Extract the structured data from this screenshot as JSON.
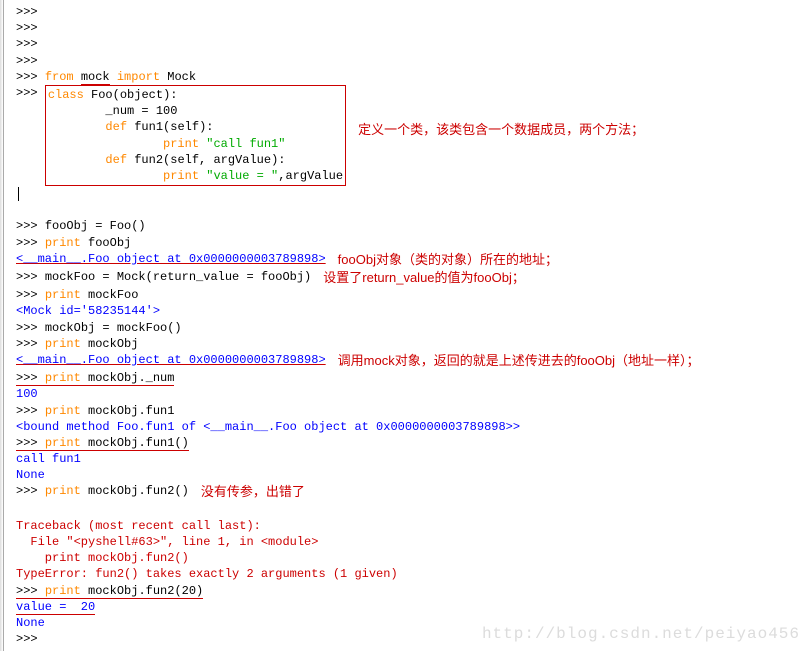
{
  "prompt": ">>> ",
  "empty_lines": [
    ">>> ",
    ">>> ",
    ">>> ",
    ">>> "
  ],
  "import_line": {
    "kw_from": "from",
    "mod": "mock",
    "kw_import": "import",
    "name": "Mock"
  },
  "class_def": {
    "kw_class": "class",
    "cls": "Foo",
    "base": "object",
    "attr": "_num = 100",
    "kw_def": "def",
    "f1": "fun1",
    "self": "self",
    "kw_print": "print",
    "s1": "\"call fun1\"",
    "f2": "fun2",
    "args2": "self, argValue",
    "s2": "\"value = \"",
    "arg2": ",argValue"
  },
  "anno1": "定义一个类，该类包含一个数据成员，两个方法；",
  "l_fooObj": "fooObj = Foo()",
  "l_print_fooObj_kw": "print",
  "l_print_fooObj": " fooObj",
  "addr1": "<__main__.Foo object at 0x0000000003789898>",
  "anno2": "fooObj对象（类的对象）所在的地址；",
  "l_mockFoo": "mockFoo = Mock(return_value = fooObj)",
  "anno3": "设置了return_value的值为fooObj；",
  "l_print_mockFoo_kw": "print",
  "l_print_mockFoo": " mockFoo",
  "mock_id": "<Mock id='58235144'>",
  "l_mockObj": "mockObj = mockFoo()",
  "l_print_mockObj_kw": "print",
  "l_print_mockObj": " mockObj",
  "addr2": "<__main__.Foo object at 0x0000000003789898>",
  "anno4": "调用mock对象，返回的就是上述传进去的fooObj（地址一样）；",
  "l_print_num_kw": "print",
  "l_print_num": " mockObj._num",
  "out_100": "100",
  "l_print_f1_kw": "print",
  "l_print_f1": " mockObj.fun1",
  "bound": "<bound method Foo.fun1 of <__main__.Foo object at 0x0000000003789898>>",
  "l_print_f1c_kw": "print",
  "l_print_f1c": " mockObj.fun1()",
  "out_call": "call fun1",
  "out_none1": "None",
  "l_print_f2_kw": "print",
  "l_print_f2": " mockObj.fun2()",
  "anno5": "没有传参，出错了",
  "tb1": "Traceback (most recent call last):",
  "tb2": "  File \"<pyshell#63>\", line 1, in <module>",
  "tb3": "    print mockObj.fun2()",
  "tb4": "TypeError: fun2() takes exactly 2 arguments (1 given)",
  "l_print_f2v_kw": "print",
  "l_print_f2v": " mockObj.fun2(20)",
  "out_val": "value =  20",
  "out_none2": "None",
  "watermark": "http://blog.csdn.net/peiyao456"
}
